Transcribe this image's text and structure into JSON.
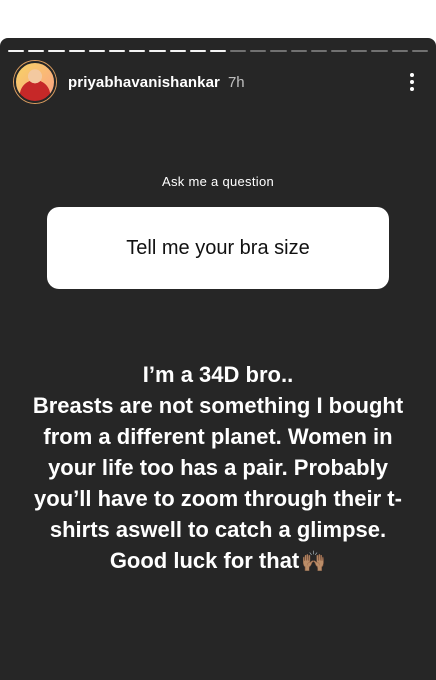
{
  "story": {
    "progress_segments": [
      {
        "done": true
      },
      {
        "done": true
      },
      {
        "done": true
      },
      {
        "done": true
      },
      {
        "done": true
      },
      {
        "done": true
      },
      {
        "done": true
      },
      {
        "done": true
      },
      {
        "done": true
      },
      {
        "done": true
      },
      {
        "done": true
      },
      {
        "done": false
      },
      {
        "done": false
      },
      {
        "done": false
      },
      {
        "done": false
      },
      {
        "done": false
      },
      {
        "done": false
      },
      {
        "done": false
      },
      {
        "done": false
      },
      {
        "done": false
      },
      {
        "done": false
      }
    ],
    "username": "priyabhavanishankar",
    "time": "7h",
    "more_icon": "more-vertical-icon"
  },
  "question": {
    "prompt": "Ask me a question",
    "text": "Tell me your bra size"
  },
  "answer": {
    "text": "I’m a 34D bro..\nBreasts are not something I bought from a different planet. Women in your life too has a pair. Probably you’ll have to zoom through their t-shirts aswell to catch a glimpse.\nGood luck for that",
    "emoji": "🙌🏽"
  },
  "colors": {
    "background": "#262626",
    "text": "#ffffff",
    "card": "#ffffff"
  }
}
